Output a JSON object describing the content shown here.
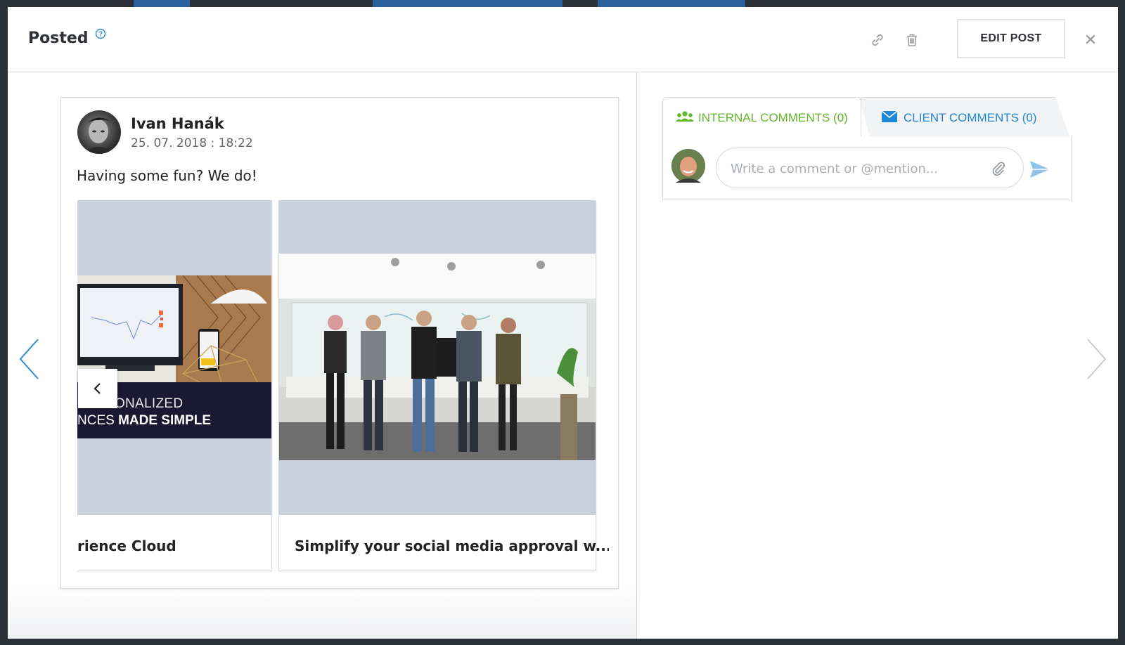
{
  "modal": {
    "title": "Posted",
    "edit_label": "EDIT POST"
  },
  "post": {
    "author": "Ivan Hanák",
    "date": "25. 07. 2018 : 18:22",
    "text": "Having some fun? We do!",
    "cards": [
      {
        "caption": "rience Cloud",
        "promo_line1": "PERSONALIZED",
        "promo_line2_prefix": "NCES",
        "promo_line2_bold": "MADE SIMPLE"
      },
      {
        "caption": "Simplify your social media approval w..."
      }
    ]
  },
  "comments": {
    "tab_internal": "INTERNAL COMMENTS (0)",
    "tab_client": "CLIENT COMMENTS (0)",
    "placeholder": "Write a comment or @mention..."
  },
  "colors": {
    "internal_tab": "#62b62a",
    "client_tab": "#1d88d6",
    "nav_arrow": "#2f8ad8",
    "thumb_bg": "#c9d2dc"
  },
  "icons": [
    "help-icon",
    "link-icon",
    "trash-icon",
    "close-icon",
    "chevron-left-icon",
    "chevron-right-icon",
    "users-icon",
    "envelope-icon",
    "paperclip-icon",
    "send-icon"
  ]
}
